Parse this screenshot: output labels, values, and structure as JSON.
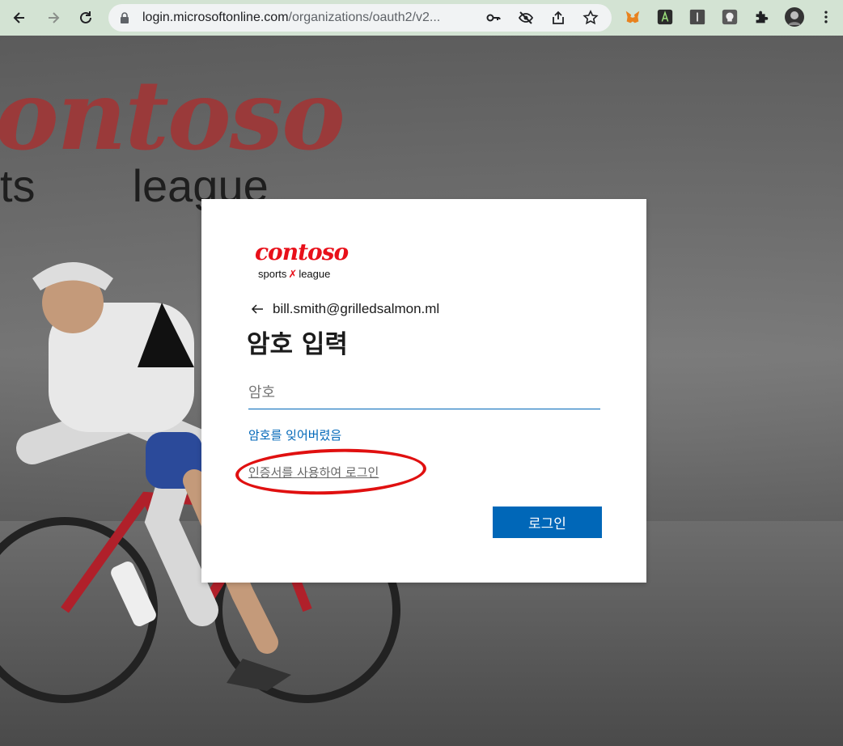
{
  "browser": {
    "url_host": "login.microsoftonline.com",
    "url_path": "/organizations/oauth2/v2...",
    "icons": [
      "back-icon",
      "forward-icon",
      "reload-icon",
      "lock-icon",
      "key-icon",
      "eye-off-icon",
      "share-icon",
      "star-icon",
      "metamask-icon",
      "extension-a-icon",
      "extension-i-icon",
      "extension-badge-icon",
      "puzzle-icon",
      "profile-avatar",
      "kebab-menu-icon"
    ]
  },
  "background": {
    "brand_text": "ontoso",
    "sub_left": "ts",
    "sub_right": "league"
  },
  "card": {
    "logo": {
      "main": "contoso",
      "sub_left": "sports",
      "sub_right": "league"
    },
    "identity": "bill.smith@grilledsalmon.ml",
    "title": "암호 입력",
    "password_placeholder": "암호",
    "forgot_link": "암호를 잊어버렸음",
    "cert_link": "인증서를 사용하여 로그인",
    "signin_button": "로그인"
  },
  "colors": {
    "accent": "#0067b8",
    "brand_red": "#e8101a",
    "annotation": "#e01010"
  }
}
